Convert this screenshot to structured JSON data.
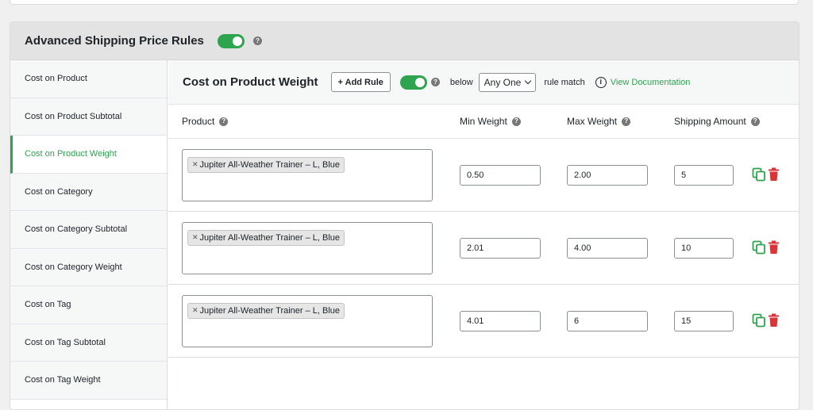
{
  "header": {
    "title": "Advanced Shipping Price Rules"
  },
  "sidebar": {
    "items": [
      {
        "label": "Cost on Product"
      },
      {
        "label": "Cost on Product Subtotal"
      },
      {
        "label": "Cost on Product Weight"
      },
      {
        "label": "Cost on Category"
      },
      {
        "label": "Cost on Category Subtotal"
      },
      {
        "label": "Cost on Category Weight"
      },
      {
        "label": "Cost on Tag"
      },
      {
        "label": "Cost on Tag Subtotal"
      },
      {
        "label": "Cost on Tag Weight"
      }
    ],
    "active_item": "Cost on Product Weight"
  },
  "main": {
    "title": "Cost on Product Weight",
    "add_rule_label": "+ Add Rule",
    "below_label": "below",
    "match_select": "Any One",
    "rule_match_label": "rule match",
    "info_glyph": "i",
    "doc_link": "View Documentation"
  },
  "table": {
    "columns": {
      "product": "Product",
      "min_weight": "Min Weight",
      "max_weight": "Max Weight",
      "shipping_amount": "Shipping Amount"
    },
    "rows": [
      {
        "product": "Jupiter All-Weather Trainer – L, Blue",
        "min": "0.50",
        "max": "2.00",
        "amount": "5"
      },
      {
        "product": "Jupiter All-Weather Trainer – L, Blue",
        "min": "2.01",
        "max": "4.00",
        "amount": "10"
      },
      {
        "product": "Jupiter All-Weather Trainer – L, Blue",
        "min": "4.01",
        "max": "6",
        "amount": "15"
      }
    ]
  },
  "colors": {
    "accent": "#2ea44f",
    "danger": "#d63638"
  },
  "icons": {
    "help": "question-icon",
    "copy": "copy-icon",
    "delete": "trash-icon",
    "info": "info-icon"
  }
}
